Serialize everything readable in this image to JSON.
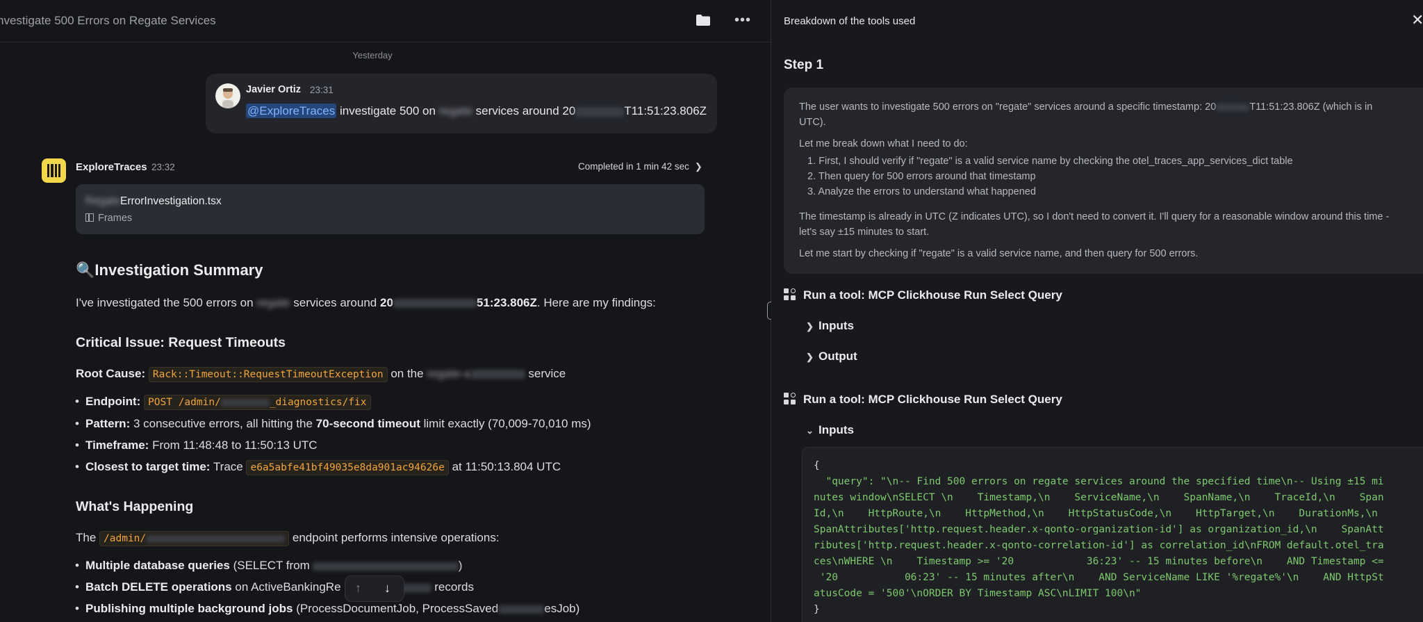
{
  "conversation": {
    "title": "nvestigate 500 Errors on Regate Services",
    "day_separator": "Yesterday"
  },
  "user_message": {
    "author": "Javier Ortiz",
    "time": "23:31",
    "mention": "@ExploreTraces",
    "text_before": "investigate 500 on",
    "text_redacted": "regate",
    "text_middle": "services around 20",
    "text_end": "T11:51:23.806Z"
  },
  "bot": {
    "name": "ExploreTraces",
    "time": "23:32",
    "completed": "Completed in 1 min 42 sec",
    "file_prefix_redacted": "Regate",
    "file_name": "ErrorInvestigation.tsx",
    "file_type": "Frames"
  },
  "summary": {
    "icon": "🔍",
    "heading": "Investigation Summary",
    "intro_before": "I've investigated the 500 errors on",
    "intro_redacted": "regate",
    "intro_middle": "services around",
    "intro_bold_start": "20",
    "intro_bold_end": "51:23.806Z",
    "intro_after": ". Here are my findings:"
  },
  "critical": {
    "heading": "Critical Issue: Request Timeouts",
    "root_label": "Root Cause:",
    "root_code": "Rack::Timeout::RequestTimeoutException",
    "root_on": "on the",
    "root_service_redacted": "regate-a",
    "root_service_suffix": "service",
    "bullets": [
      {
        "label": "Endpoint:",
        "code_start": "POST /admin/",
        "code_end": "_diagnostics/fix"
      },
      {
        "label": "Pattern:",
        "text": "3 consecutive errors, all hitting the",
        "bold": "70-second timeout",
        "text2": "limit exactly (70,009-70,010 ms)"
      },
      {
        "label": "Timeframe:",
        "text": "From 11:48:48 to 11:50:13 UTC"
      },
      {
        "label": "Closest to target time:",
        "text": "Trace",
        "code": "e6a5abfe41bf49035e8da901ac94626e",
        "text2": "at 11:50:13.804 UTC"
      }
    ]
  },
  "happening": {
    "heading": "What's Happening",
    "the": "The",
    "code": "/admin/",
    "after": "endpoint performs intensive operations:",
    "bullets": [
      {
        "bold": "Multiple database queries",
        "text": "(SELECT from"
      },
      {
        "bold": "Batch DELETE operations",
        "text": "on ActiveBankingRe",
        "text2": "records"
      },
      {
        "bold": "Publishing multiple background jobs",
        "text": "(ProcessDocumentJob, ProcessSaved",
        "text2": "esJob)"
      }
    ]
  },
  "scroll_controls": {
    "up": "↑",
    "down": "↓"
  },
  "tools_panel": {
    "header": "Breakdown of the tools used",
    "close": "✕",
    "step": "Step 1",
    "thinking": [
      "The user wants to investigate 500 errors on \"regate\" services around a specific timestamp: 20",
      "T11:51:23.806Z (which is in",
      "UTC).",
      "Let me break down what I need to do:",
      "1. First, I should verify if \"regate\" is a valid service name by checking the otel_traces_app_services_dict table",
      "2. Then query for 500 errors around that timestamp",
      "3. Analyze the errors to understand what happened",
      "The timestamp is already in UTC (Z indicates UTC), so I don't need to convert it. I'll query for a reasonable window around this time -",
      "let's say ±15 minutes to start.",
      "Let me start by checking if \"regate\" is a valid service name, and then query for 500 errors."
    ],
    "tool1": {
      "label": "Run a tool: MCP Clickhouse Run Select Query",
      "inputs": "Inputs",
      "output": "Output"
    },
    "tool2": {
      "label": "Run a tool: MCP Clickhouse Run Select Query",
      "inputs": "Inputs"
    },
    "code_lines": [
      "{",
      "  \"query\": \"\\n-- Find 500 errors on regate services around the specified time\\n-- Using ±15 mi",
      "nutes window\\nSELECT \\n    Timestamp,\\n    ServiceName,\\n    SpanName,\\n    TraceId,\\n    Span",
      "Id,\\n    HttpRoute,\\n    HttpMethod,\\n    HttpStatusCode,\\n    HttpTarget,\\n    DurationMs,\\n",
      "SpanAttributes['http.request.header.x-qonto-organization-id'] as organization_id,\\n    SpanAtt",
      "ributes['http.request.header.x-qonto-correlation-id'] as correlation_id\\nFROM default.otel_tra",
      "ces\\nWHERE \\n    Timestamp >= '20            36:23' -- 15 minutes before\\n    AND Timestamp <=",
      " '20           06:23' -- 15 minutes after\\n    AND ServiceName LIKE '%regate%'\\n    AND HttpSt",
      "atusCode = '500'\\nORDER BY Timestamp ASC\\nLIMIT 100\\n\"",
      "}"
    ]
  }
}
